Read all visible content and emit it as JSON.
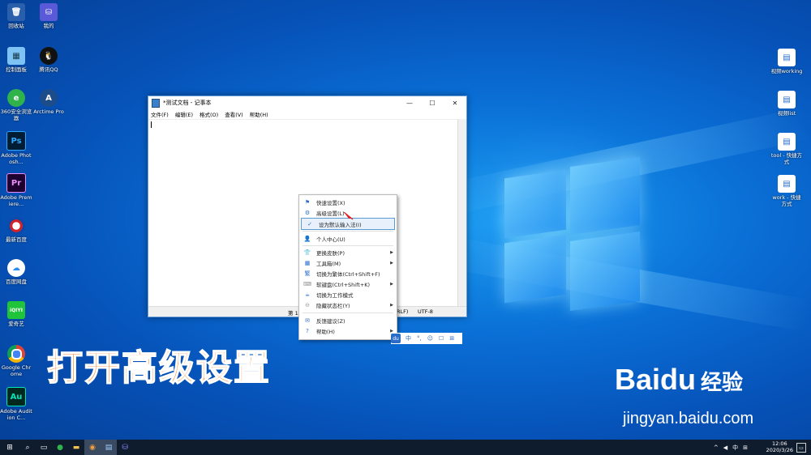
{
  "desktop": {
    "left_icons": [
      {
        "label": "回收站",
        "icon": "recycle-bin-icon"
      },
      {
        "label": "我的",
        "icon": "user-app-icon"
      },
      {
        "label": "控制面板",
        "icon": "control-panel-icon"
      },
      {
        "label": "腾讯QQ",
        "icon": "qq-icon"
      },
      {
        "label": "360安全浏览器",
        "icon": "360-browser-icon"
      },
      {
        "label": "Arctime Pro",
        "icon": "arctime-icon"
      },
      {
        "label": "Adobe Photosh...",
        "icon": "photoshop-icon",
        "glyph": "Ps"
      },
      {
        "label": "Adobe Premiere...",
        "icon": "premiere-icon",
        "glyph": "Pr"
      },
      {
        "label": "最新百度",
        "icon": "pepsi-app-icon"
      },
      {
        "label": "百度网盘",
        "icon": "baidu-netdisk-icon"
      },
      {
        "label": "爱奇艺",
        "icon": "iqiyi-icon",
        "glyph": "iQIYI"
      },
      {
        "label": "Google Chrome",
        "icon": "chrome-icon"
      },
      {
        "label": "Adobe Audition C...",
        "icon": "audition-icon",
        "glyph": "Au"
      }
    ],
    "right_icons": [
      {
        "label": "视频working",
        "icon": "file-shortcut-icon"
      },
      {
        "label": "视频list",
        "icon": "file-shortcut-icon"
      },
      {
        "label": "tool - 快捷方式",
        "icon": "file-shortcut-icon"
      },
      {
        "label": "work - 快捷方式",
        "icon": "file-shortcut-icon"
      }
    ]
  },
  "notepad": {
    "title": "*测试文档 - 记事本",
    "controls": {
      "minimize": "—",
      "maximize": "☐",
      "close": "✕"
    },
    "menu": [
      "文件(F)",
      "编辑(E)",
      "格式(O)",
      "查看(V)",
      "帮助(H)"
    ],
    "status": {
      "position": "第 1",
      "eol": "RLF)",
      "encoding": "UTF-8"
    }
  },
  "context_menu": {
    "items": [
      {
        "label": "快速设置(X)",
        "icon": "flag-icon"
      },
      {
        "label": "高级设置(L)",
        "icon": "gear-icon"
      },
      {
        "label": "设为默认输入法(I)",
        "icon": "check-circle-icon",
        "selected": true
      },
      {
        "label": "个人中心(U)",
        "icon": "person-icon"
      },
      {
        "label": "更换皮肤(P)",
        "icon": "skin-icon",
        "submenu": true
      },
      {
        "label": "工具箱(M)",
        "icon": "toolbox-icon",
        "submenu": true
      },
      {
        "label": "切换为繁体(Ctrl+Shift+F)",
        "icon": "traditional-icon"
      },
      {
        "label": "软键盘(Ctrl+Shift+K)",
        "icon": "keyboard-icon",
        "submenu": true
      },
      {
        "label": "切换为工作模式",
        "icon": "work-mode-icon"
      },
      {
        "label": "隐藏状态栏(Y)",
        "icon": "hide-icon",
        "submenu": true
      },
      {
        "label": "反馈建议(Z)",
        "icon": "feedback-icon"
      },
      {
        "label": "帮助(H)",
        "icon": "help-icon",
        "submenu": true
      }
    ]
  },
  "ime_bar": {
    "logo": "du",
    "items": [
      "中",
      "°,",
      "☺",
      "☐",
      "⊞"
    ]
  },
  "caption": "打开高级设置",
  "watermark": {
    "brand": "Baidu",
    "suffix": "经验",
    "url": "jingyan.baidu.com"
  },
  "taskbar": {
    "tray": [
      "^",
      "◀",
      "中",
      "⊞"
    ],
    "time": "12:06",
    "date": "2020/3/26"
  }
}
